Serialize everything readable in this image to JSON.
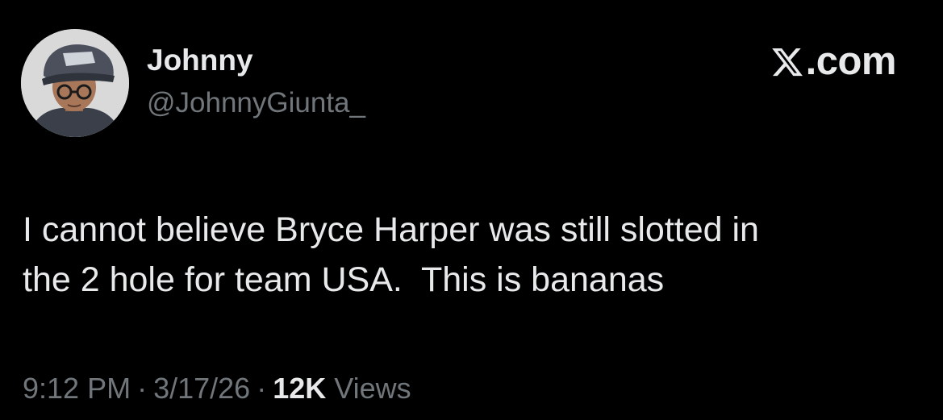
{
  "author": {
    "display_name": "Johnny",
    "handle": "@JohnnyGiunta_"
  },
  "brand": {
    "icon": "x-logo-icon",
    "text": ".com"
  },
  "tweet": {
    "text": "I cannot believe Bryce Harper was still slotted in\nthe 2 hole for team USA.  This is bananas"
  },
  "meta": {
    "time": "9:12 PM",
    "separator": "·",
    "date": "3/17/26",
    "views_count": "12K",
    "views_label": "Views"
  },
  "colors": {
    "background": "#000000",
    "primary_text": "#e7e9ea",
    "secondary_text": "#71767b"
  }
}
